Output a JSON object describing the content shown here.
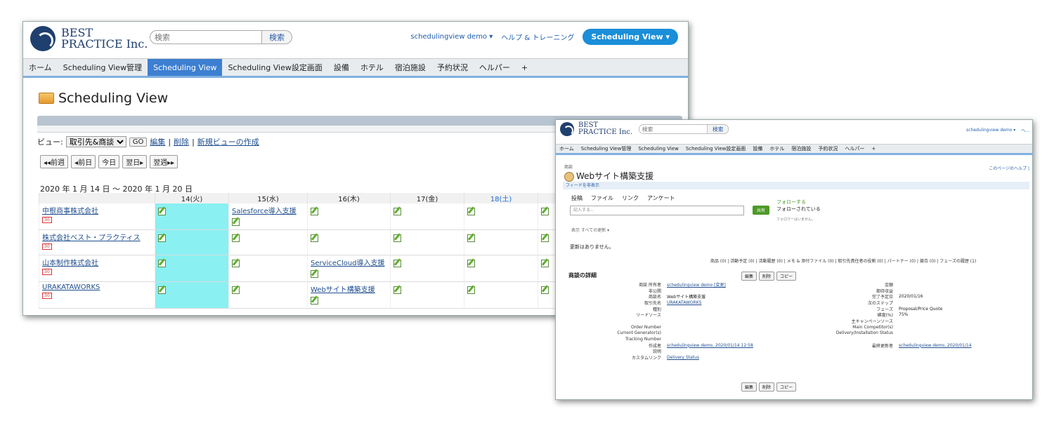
{
  "win1": {
    "logo": {
      "line1": "BEST",
      "line2": "PRACTICE Inc."
    },
    "search": {
      "placeholder": "検索",
      "button": "検索"
    },
    "header": {
      "user": "schedulingview demo ▾",
      "help": "ヘルプ & トレーニング",
      "app_button": "Scheduling View ▾"
    },
    "tabs": [
      "ホーム",
      "Scheduling View管理",
      "Scheduling View",
      "Scheduling View設定画面",
      "設備",
      "ホテル",
      "宿泊施設",
      "予約状況",
      "ヘルパー",
      "+"
    ],
    "page_title": "Scheduling View",
    "view": {
      "label": "ビュー:",
      "selected": "取引先&商談",
      "go": "GO",
      "edit": "編集",
      "delete": "削除",
      "create": "新規ビューの作成"
    },
    "nav": [
      "◂◂前週",
      "◂前日",
      "今日",
      "翌日▸",
      "翌週▸▸"
    ],
    "date_range": "2020 年 1 月 14 日 ～ 2020 年 1 月 20 日",
    "columns": [
      "14(火)",
      "15(水)",
      "16(木)",
      "17(金)",
      "18(土)",
      ""
    ],
    "rows": [
      {
        "account": "中根商事株式会社",
        "cells": [
          "",
          "Salesforce導入支援",
          "",
          "",
          "",
          ""
        ]
      },
      {
        "account": "株式会社ベスト・プラクティス",
        "cells": [
          "",
          "",
          "",
          "",
          "",
          ""
        ]
      },
      {
        "account": "山本制作株式会社",
        "cells": [
          "",
          "",
          "ServiceCloud導入支援",
          "",
          "",
          ""
        ]
      },
      {
        "account": "URAKATAWORKS",
        "cells": [
          "",
          "",
          "Webサイト構築支援",
          "",
          "",
          ""
        ]
      }
    ],
    "badge": "30"
  },
  "win2": {
    "logo": {
      "line1": "BEST",
      "line2": "PRACTICE Inc."
    },
    "search": {
      "placeholder": "検索",
      "button": "検索"
    },
    "header": {
      "user": "schedulingview demo ▾",
      "trail": "ヘ..."
    },
    "tabs": [
      "ホーム",
      "Scheduling View管理",
      "Scheduling View",
      "Scheduling View設定画面",
      "設備",
      "ホテル",
      "宿泊施設",
      "予約状況",
      "ヘルパー",
      "+"
    ],
    "record_type": "商談",
    "record_name": "Webサイト構築支援",
    "page_help": "このページのヘルプ |",
    "feed_toggle": "フィードを非表示",
    "publisher_tabs": [
      "投稿",
      "ファイル",
      "リンク",
      "アンケート"
    ],
    "post_placeholder": "記入する...",
    "share": "共有",
    "follow": {
      "action": "フォローする",
      "status": "フォローされている",
      "note": "フォロワーはいません。"
    },
    "feed_filter": "表示 すべての更新 ▾",
    "no_updates": "更新はありません。",
    "related": "商品 (0) | 活動予定 (0) | 活動履歴 (0) | メモ & 添付ファイル (0) | 取引先責任者の役割 (0) | パートナー (0) | 競合 (0) | フェーズの履歴 (1)",
    "section": "商談の詳細",
    "buttons": [
      "編集",
      "削除",
      "コピー"
    ],
    "fields": [
      {
        "l": "商談 所有者",
        "v": "schedulingview demo [変更]",
        "l2": "金額",
        "v2": ""
      },
      {
        "l": "非公開",
        "v": "",
        "l2": "期待収益",
        "v2": ""
      },
      {
        "l": "商談名",
        "v": "Webサイト構築支援",
        "l2": "完了予定日",
        "v2": "2020/01/16"
      },
      {
        "l": "取引先名",
        "v": "URAKATAWORKS",
        "l2": "次のステップ",
        "v2": ""
      },
      {
        "l": "種別",
        "v": "",
        "l2": "フェーズ",
        "v2": "Proposal/Price Quote"
      },
      {
        "l": "リードソース",
        "v": "",
        "l2": "確度(%)",
        "v2": "75%"
      },
      {
        "l": "",
        "v": "",
        "l2": "主キャンペーンソース",
        "v2": ""
      },
      {
        "l": "Order Number",
        "v": "",
        "l2": "Main Competitor(s)",
        "v2": ""
      },
      {
        "l": "Current Generator(s)",
        "v": "",
        "l2": "Delivery/Installation Status",
        "v2": ""
      },
      {
        "l": "Tracking Number",
        "v": "",
        "l2": "",
        "v2": ""
      },
      {
        "l": "作成者",
        "v": "schedulingview demo, 2020/01/14 12:58",
        "l2": "最終更新者",
        "v2": "schedulingview demo, 2020/01/14"
      },
      {
        "l": "説明",
        "v": "",
        "l2": "",
        "v2": ""
      },
      {
        "l": "カスタムリンク",
        "v": "Delivery Status",
        "l2": "",
        "v2": ""
      }
    ]
  }
}
